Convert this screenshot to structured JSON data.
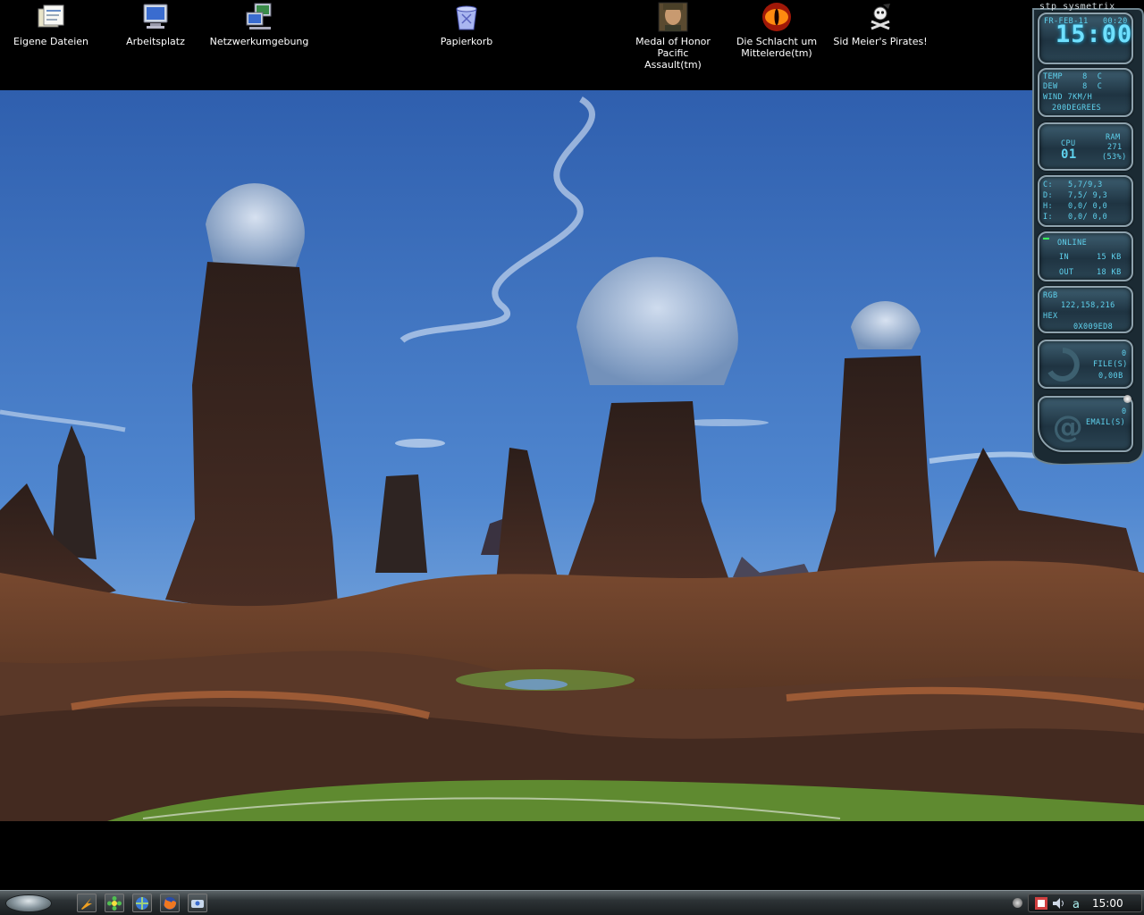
{
  "desktop_icons": [
    {
      "label": "Eigene Dateien",
      "icon": "my-documents-icon"
    },
    {
      "label": "Arbeitsplatz",
      "icon": "my-computer-icon"
    },
    {
      "label": "Netzwerkumgebung",
      "icon": "network-icon"
    },
    {
      "label": "Papierkorb",
      "icon": "recycle-bin-icon"
    },
    {
      "label": "Medal of Honor Pacific\nAssault(tm)",
      "icon": "medal-of-honor-icon"
    },
    {
      "label": "Die Schlacht um\nMittelerde(tm)",
      "icon": "eye-of-sauron-icon"
    },
    {
      "label": "Sid Meier's Pirates!",
      "icon": "pirate-flag-icon"
    }
  ],
  "sysmetrix": {
    "title": "stp sysmetrix",
    "date": "FR-FEB-11",
    "time_small": "00:20",
    "clock": "15:00",
    "weather": {
      "temp": "TEMP    8  C",
      "dew": "DEW     8  C",
      "wind": "WIND 7KM/H",
      "dir": "200DEGREES"
    },
    "cpu": {
      "label": "CPU",
      "value": "01",
      "ram_label": "RAM",
      "ram_value": "271",
      "ram_pct": "(53%)"
    },
    "drives": [
      {
        "l": "C:",
        "v": "5,7/9,3"
      },
      {
        "l": "D:",
        "v": "7,5/ 9,3"
      },
      {
        "l": "H:",
        "v": "0,0/ 0,0"
      },
      {
        "l": "I:",
        "v": "0,0/ 0,0"
      }
    ],
    "net": {
      "status": "ONLINE",
      "in_label": "IN",
      "in": "15 KB",
      "out_label": "OUT",
      "out": "18 KB"
    },
    "color": {
      "rgb_label": "RGB",
      "rgb": "122,158,216",
      "hex_label": "HEX",
      "hex": "0X009ED8"
    },
    "recycle": {
      "count": "0",
      "files": "FILE(S)",
      "size": "0,00B"
    },
    "email": {
      "count": "0",
      "label": "EMAIL(S)"
    }
  },
  "taskbar": {
    "clock": "15:00",
    "quicklaunch": [
      "winamp-icon",
      "flower-icon",
      "explorer-icon",
      "firefox-icon",
      "messenger-icon"
    ],
    "tray": [
      "tray-app-icon",
      "volume-icon",
      "network-tray-icon"
    ]
  },
  "colors": {
    "accent": "#5fd2ee",
    "sky": "#3f74c2",
    "rock": "#4a3028"
  }
}
